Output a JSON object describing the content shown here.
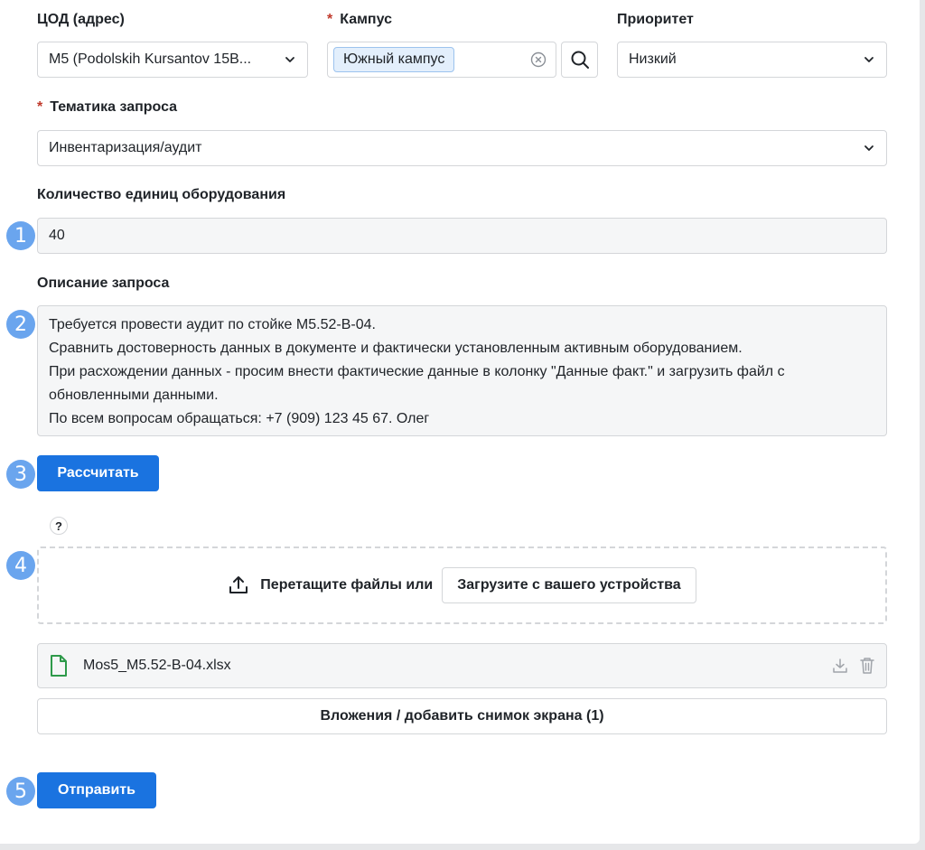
{
  "fields": {
    "tsod": {
      "label": "ЦОД (адрес)",
      "value": "M5 (Podolskih Kursantov 15B..."
    },
    "campus": {
      "required_mark": "*",
      "label": "Кампус",
      "chip": "Южный кампус"
    },
    "priority": {
      "label": "Приоритет",
      "value": "Низкий"
    },
    "topic": {
      "required_mark": "*",
      "label": "Тематика запроса",
      "value": "Инвентаризация/аудит"
    },
    "equipment_count": {
      "label": "Количество единиц оборудования",
      "value": "40"
    },
    "description": {
      "label": "Описание запроса",
      "value": "Требуется провести аудит по стойке M5.52-B-04.\nСравнить достоверность данных в документе и фактически установленным активным оборудованием.\nПри расхождении данных - просим внести фактические данные в колонку \"Данные факт.\" и загрузить файл с обновленными данными.\nПо всем вопросам обращаться: +7 (909) 123 45 67. Олег"
    }
  },
  "buttons": {
    "calculate": "Рассчитать",
    "upload_from_device": "Загрузите с вашего устройства",
    "attachments": "Вложения / добавить снимок экрана (1)",
    "submit": "Отправить"
  },
  "help": {
    "symbol": "?"
  },
  "dropzone": {
    "text": "Перетащите файлы или"
  },
  "attached_file": {
    "name": "Mos5_M5.52-B-04.xlsx"
  },
  "step_badges": [
    "1",
    "2",
    "3",
    "4",
    "5"
  ],
  "colors": {
    "primary": "#1a73e0",
    "badge": "#6aa5ee",
    "required": "#c0392b",
    "file_icon": "#2e9a4a"
  }
}
